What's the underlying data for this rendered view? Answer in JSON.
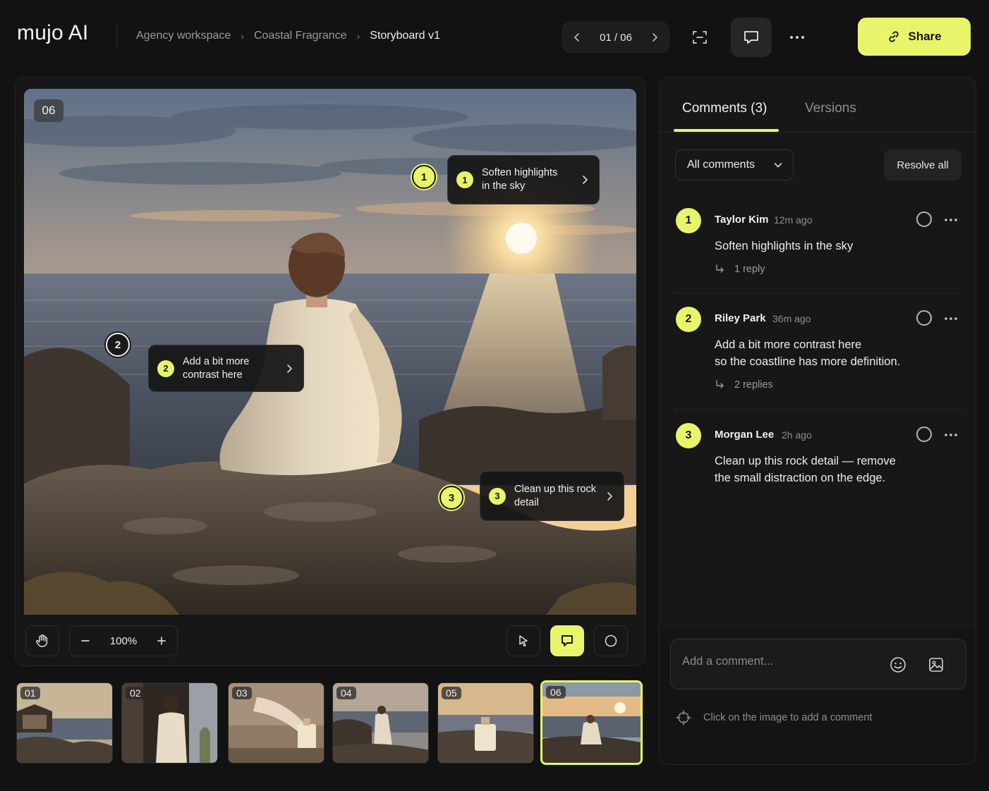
{
  "header": {
    "logo": "mujo AI",
    "breadcrumb": [
      "Agency workspace",
      "Coastal Fragrance",
      "Storyboard v1"
    ],
    "pager": "01 / 06",
    "share_label": "Share"
  },
  "canvas": {
    "frame_badge": "06",
    "pins": [
      "1",
      "2",
      "3"
    ],
    "notes": [
      {
        "num": "1",
        "text_line1": "Soften highlights",
        "text_line2": "in the sky"
      },
      {
        "num": "2",
        "text_line1": "Add a bit more",
        "text_line2": "contrast here"
      },
      {
        "num": "3",
        "text_line1": "Clean up this rock",
        "text_line2": "detail"
      }
    ]
  },
  "toolbar": {
    "zoom": "100%"
  },
  "filmstrip": [
    "01",
    "02",
    "03",
    "04",
    "05",
    "06"
  ],
  "panel": {
    "tabs": [
      "Comments (3)",
      "Versions"
    ],
    "filter": "All comments",
    "resolve_all": "Resolve all",
    "comments": [
      {
        "num": "1",
        "author": "Taylor Kim",
        "time": "12m ago",
        "line1": "Soften highlights in the sky",
        "line2": "",
        "replies": "1 reply"
      },
      {
        "num": "2",
        "author": "Riley Park",
        "time": "36m ago",
        "line1": "Add a bit more contrast here",
        "line2": "so the coastline has more definition.",
        "replies": "2 replies"
      },
      {
        "num": "3",
        "author": "Morgan Lee",
        "time": "2h ago",
        "line1": "Clean up this rock detail — remove",
        "line2": "the small distraction on the edge.",
        "replies": ""
      }
    ],
    "composer_placeholder": "Add a comment...",
    "hint": "Click on the image to add a comment"
  },
  "colors": {
    "accent": "#e8f56a",
    "background": "#121212",
    "panel": "#171717"
  }
}
